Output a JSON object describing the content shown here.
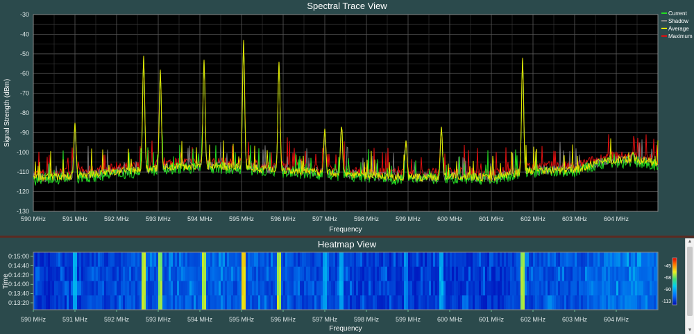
{
  "spectral": {
    "title": "Spectral Trace View",
    "ylabel": "Signal Strength (dBm)",
    "xlabel": "Frequency",
    "legend": [
      {
        "label": "Current",
        "color": "#22dd22"
      },
      {
        "label": "Shadow",
        "color": "#8a8a8a"
      },
      {
        "label": "Average",
        "color": "#e6e600"
      },
      {
        "label": "Maximum",
        "color": "#e01010"
      }
    ]
  },
  "heatmap": {
    "title": "Heatmap View",
    "ylabel": "Time",
    "xlabel": "Frequency",
    "time_ticks": [
      "0:15:00",
      "0:14:40",
      "0:14:20",
      "0:14:00",
      "0:13:40",
      "0:13:20"
    ],
    "scale_ticks": [
      "-45",
      "-68",
      "-90",
      "-113"
    ]
  },
  "chart_data": {
    "type": "line",
    "x_unit": "MHz",
    "xlim": [
      590,
      605
    ],
    "ylim": [
      -130,
      -30
    ],
    "x_ticks": [
      "590 MHz",
      "591 MHz",
      "592 MHz",
      "593 MHz",
      "594 MHz",
      "595 MHz",
      "596 MHz",
      "597 MHz",
      "598 MHz",
      "599 MHz",
      "600 MHz",
      "601 MHz",
      "602 MHz",
      "603 MHz",
      "604 MHz"
    ],
    "y_ticks": [
      -30,
      -40,
      -50,
      -60,
      -70,
      -80,
      -90,
      -100,
      -110,
      -120,
      -130
    ],
    "grid": true,
    "legend_position": "top-right",
    "peaks": [
      {
        "x": 591.0,
        "y": -85
      },
      {
        "x": 592.65,
        "y": -51
      },
      {
        "x": 593.05,
        "y": -58
      },
      {
        "x": 594.1,
        "y": -53
      },
      {
        "x": 595.05,
        "y": -43
      },
      {
        "x": 595.9,
        "y": -54
      },
      {
        "x": 597.0,
        "y": -88
      },
      {
        "x": 597.4,
        "y": -87
      },
      {
        "x": 598.95,
        "y": -94
      },
      {
        "x": 599.8,
        "y": -87
      },
      {
        "x": 601.75,
        "y": -52
      },
      {
        "x": 604.4,
        "y": -100
      }
    ],
    "noise_floor": [
      {
        "x": 590.0,
        "y": -114
      },
      {
        "x": 591.0,
        "y": -113
      },
      {
        "x": 592.0,
        "y": -111
      },
      {
        "x": 593.5,
        "y": -108
      },
      {
        "x": 594.5,
        "y": -108
      },
      {
        "x": 596.0,
        "y": -110
      },
      {
        "x": 597.5,
        "y": -112
      },
      {
        "x": 599.0,
        "y": -114
      },
      {
        "x": 600.3,
        "y": -113
      },
      {
        "x": 601.0,
        "y": -114
      },
      {
        "x": 602.0,
        "y": -110
      },
      {
        "x": 603.0,
        "y": -110
      },
      {
        "x": 603.8,
        "y": -105
      },
      {
        "x": 604.7,
        "y": -105
      },
      {
        "x": 605.0,
        "y": -107
      }
    ]
  }
}
